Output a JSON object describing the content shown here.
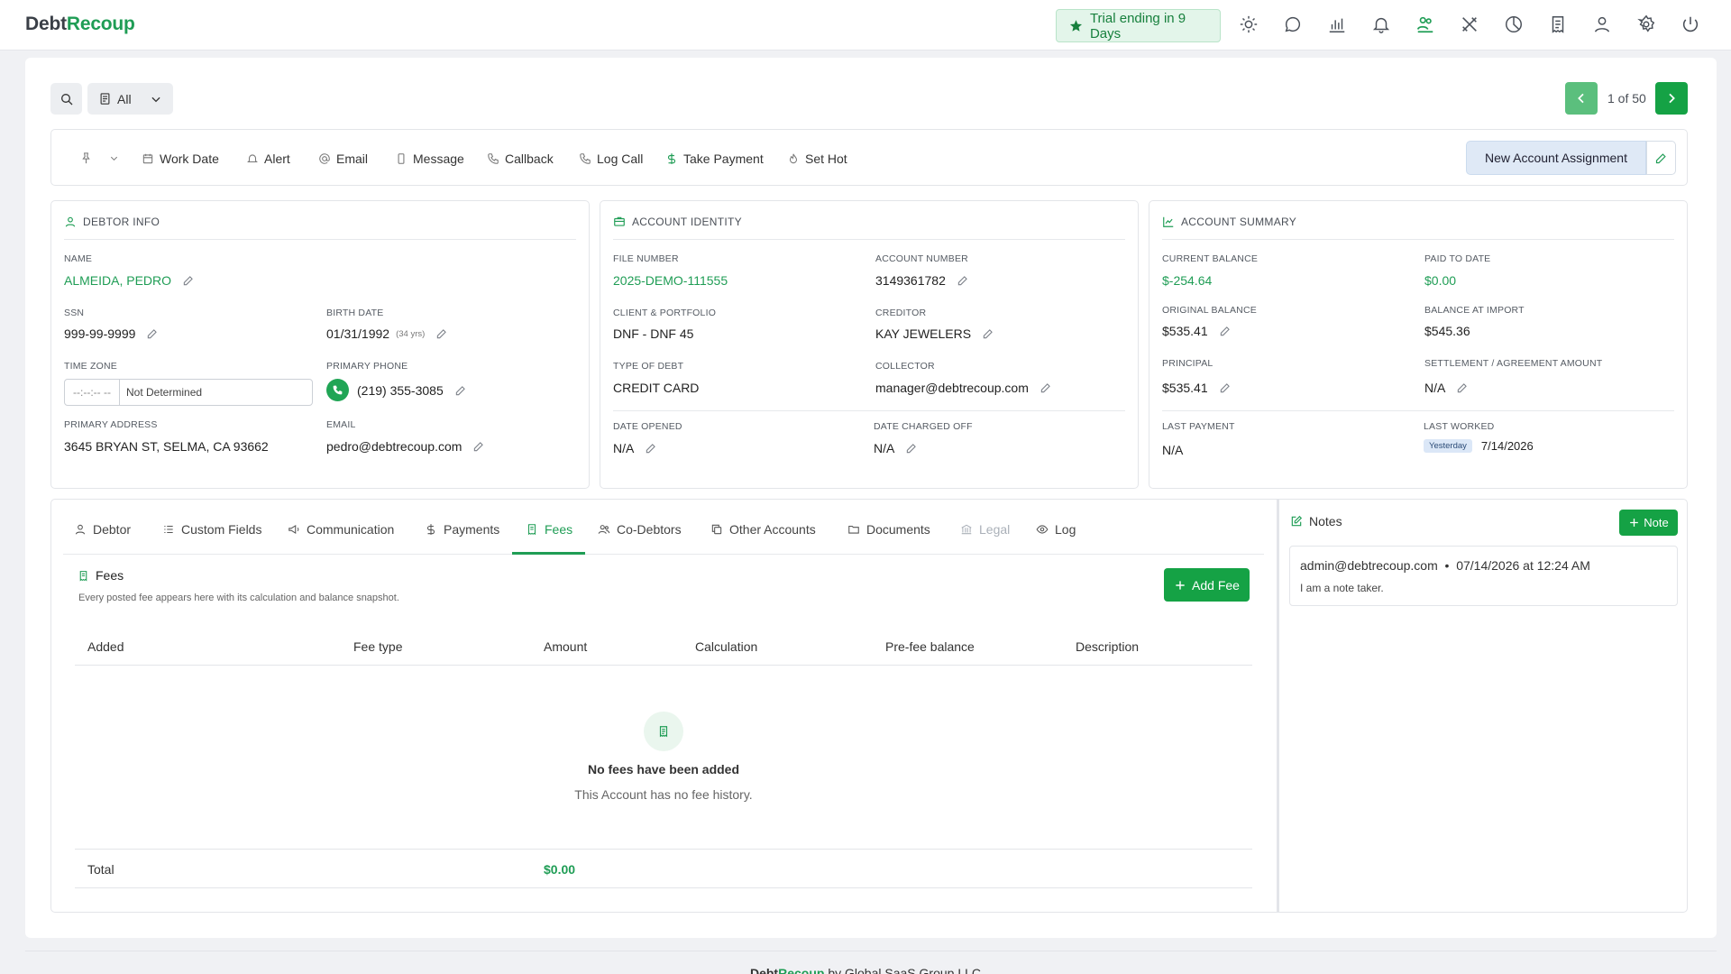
{
  "brand": {
    "part1": "Debt",
    "part2": "Recoup"
  },
  "trial": {
    "label": "Trial ending in 9 Days"
  },
  "header_icons": [
    "sun-icon",
    "chat-icon",
    "bar-chart-icon",
    "bell-icon",
    "users-money-icon",
    "tools-icon",
    "pie-chart-icon",
    "receipt-icon",
    "user-icon",
    "gear-icon",
    "power-icon"
  ],
  "filter": {
    "selected": "All"
  },
  "pagination": {
    "text": "1 of 50"
  },
  "toolbar": {
    "work_date": "Work Date",
    "alert": "Alert",
    "email": "Email",
    "message": "Message",
    "callback": "Callback",
    "log_call": "Log Call",
    "take_payment": "Take Payment",
    "set_hot": "Set Hot",
    "assignment": "New Account Assignment"
  },
  "debtor_info": {
    "title": "DEBTOR INFO",
    "name_label": "NAME",
    "name": "ALMEIDA, PEDRO",
    "ssn_label": "SSN",
    "ssn": "999-99-9999",
    "birth_label": "BIRTH DATE",
    "birth": "01/31/1992",
    "age": "(34 yrs)",
    "tz_label": "TIME ZONE",
    "tz_time": "--:--:-- --",
    "tz_value": "Not Determined",
    "phone_label": "PRIMARY PHONE",
    "phone": "(219) 355-3085",
    "address_label": "PRIMARY ADDRESS",
    "address": "3645 BRYAN ST, SELMA, CA 93662",
    "email_label": "EMAIL",
    "email": "pedro@debtrecoup.com"
  },
  "account_identity": {
    "title": "ACCOUNT IDENTITY",
    "file_label": "FILE NUMBER",
    "file": "2025-DEMO-111555",
    "acct_label": "ACCOUNT NUMBER",
    "acct": "3149361782",
    "client_label": "CLIENT & PORTFOLIO",
    "client": "DNF - DNF 45",
    "creditor_label": "CREDITOR",
    "creditor": "KAY JEWELERS",
    "type_label": "TYPE OF DEBT",
    "type": "CREDIT CARD",
    "collector_label": "COLLECTOR",
    "collector": "manager@debtrecoup.com",
    "opened_label": "DATE OPENED",
    "opened": "N/A",
    "chargeoff_label": "DATE CHARGED OFF",
    "chargeoff": "N/A"
  },
  "account_summary": {
    "title": "ACCOUNT SUMMARY",
    "current_label": "CURRENT BALANCE",
    "current": "$-254.64",
    "paid_label": "PAID TO DATE",
    "paid": "$0.00",
    "original_label": "ORIGINAL BALANCE",
    "original": "$535.41",
    "import_label": "BALANCE AT IMPORT",
    "import": "$545.36",
    "principal_label": "PRINCIPAL",
    "principal": "$535.41",
    "settle_label": "SETTLEMENT / AGREEMENT AMOUNT",
    "settle": "N/A",
    "lastpay_label": "LAST PAYMENT",
    "lastpay": "N/A",
    "lastworked_label": "LAST WORKED",
    "lastworked_badge": "Yesterday",
    "lastworked": "7/14/2026"
  },
  "tabs": [
    "Debtor",
    "Custom Fields",
    "Communication",
    "Payments",
    "Fees",
    "Co-Debtors",
    "Other Accounts",
    "Documents",
    "Legal",
    "Log"
  ],
  "active_tab": "Fees",
  "fees": {
    "title": "Fees",
    "subtitle": "Every posted fee appears here with its calculation and balance snapshot.",
    "add_label": "Add Fee",
    "columns": [
      "Added",
      "Fee type",
      "Amount",
      "Calculation",
      "Pre-fee balance",
      "Description"
    ],
    "empty_title": "No fees have been added",
    "empty_sub": "This Account has no fee history.",
    "total_label": "Total",
    "total_value": "$0.00"
  },
  "notes": {
    "title": "Notes",
    "add_label": "Note",
    "items": [
      {
        "meta": "admin@debtrecoup.com  •  07/14/2026 at 12:24 AM",
        "body": "I am a note taker."
      }
    ]
  },
  "footer": {
    "brand1": "Debt",
    "brand2": "Recoup",
    "text": " by  Global SaaS Group LLC"
  },
  "colors": {
    "accent": "#1f9d55",
    "button": "#15a245",
    "assignment_bg": "#dfe9f6"
  }
}
